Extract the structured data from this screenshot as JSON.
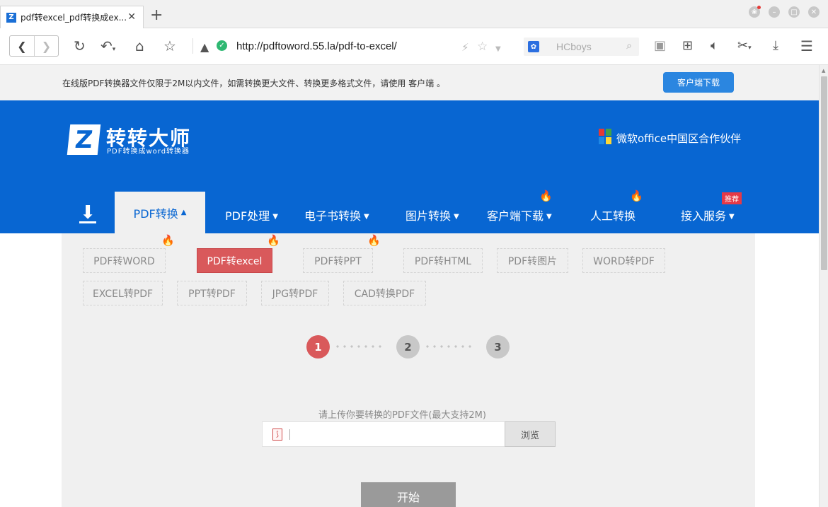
{
  "browser": {
    "tab_title": "pdf转excel_pdf转换成ex...",
    "tab_close": "✕",
    "new_tab": "+",
    "favicon_letter": "Z",
    "address": "http://pdftoword.55.la/pdf-to-excel/",
    "search_placeholder": "HCboys",
    "window_controls": [
      "skin",
      "minimize",
      "maximize",
      "close"
    ]
  },
  "notice": {
    "text": "在线版PDF转换器文件仅限于2M以内文件，如需转换更大文件、转换更多格式文件，请使用 客户端 。",
    "button": "客户端下载"
  },
  "header": {
    "logo_mark": "Z",
    "logo_name": "转转大师",
    "logo_sub": "PDF转换成word转换器",
    "partner": "微软office中国区合作伙伴",
    "partner_colors": [
      "#e53935",
      "#43a047",
      "#1e88e5",
      "#fdd835"
    ]
  },
  "nav": {
    "items": [
      {
        "label": "PDF转换",
        "caret": "▲"
      },
      {
        "label": "PDF处理",
        "caret": "▼"
      },
      {
        "label": "电子书转换",
        "caret": "▼"
      },
      {
        "label": "图片转换",
        "caret": "▼"
      },
      {
        "label": "客户端下载",
        "caret": "▼"
      },
      {
        "label": "人工转换",
        "caret": ""
      },
      {
        "label": "接入服务",
        "caret": "▼"
      }
    ],
    "recommend_badge": "推荐"
  },
  "converters": [
    {
      "label": "PDF转WORD",
      "hot": true
    },
    {
      "label": "PDF转excel",
      "hot": true,
      "active": true
    },
    {
      "label": "PDF转PPT",
      "hot": true
    },
    {
      "label": "PDF转HTML"
    },
    {
      "label": "PDF转图片"
    },
    {
      "label": "WORD转PDF"
    },
    {
      "label": "EXCEL转PDF"
    },
    {
      "label": "PPT转PDF"
    },
    {
      "label": "JPG转PDF"
    },
    {
      "label": "CAD转换PDF"
    }
  ],
  "steps": [
    "1",
    "2",
    "3"
  ],
  "current_step": 1,
  "upload": {
    "label": "请上传你要转换的PDF文件(最大支持2M)",
    "browse": "浏览",
    "start": "开始",
    "file_icon": "pdf-icon"
  },
  "colors": {
    "brand_blue": "#0866d2",
    "active_red": "#d9595b",
    "button_blue": "#2b86e0"
  }
}
